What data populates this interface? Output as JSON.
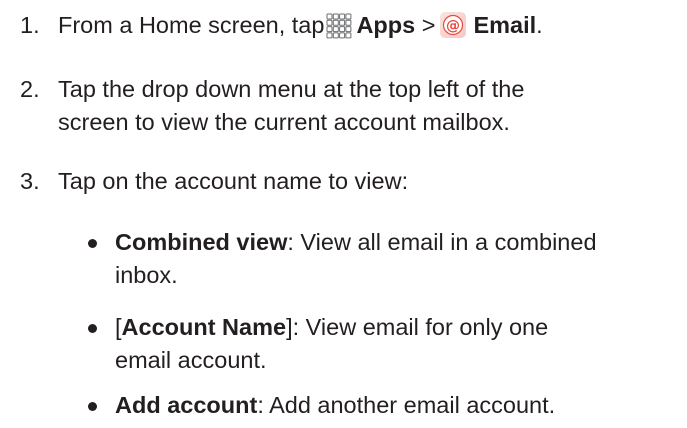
{
  "steps": [
    {
      "number": "1.",
      "text_before": "From a Home screen, tap",
      "apps_icon": "apps-grid-icon",
      "apps_label": "Apps",
      "separator": ">",
      "email_icon": "email-app-icon",
      "email_label": "Email",
      "end": "."
    },
    {
      "number": "2.",
      "line1": "Tap the drop down menu at the top left of the",
      "line2": "screen to view the current account mailbox."
    },
    {
      "number": "3.",
      "text": "Tap on the account name to view:"
    }
  ],
  "bullets": [
    {
      "term": "Combined view",
      "rest_line1": ": View all email in a combined",
      "rest_line2": "inbox."
    },
    {
      "open": "[",
      "term": "Account Name",
      "close": "]",
      "rest_line1": ": View email for only one",
      "rest_line2": "email account."
    },
    {
      "term": "Add account",
      "rest_line1": ": Add another email account."
    }
  ],
  "colors": {
    "text": "#231f20",
    "email_icon_red": "#e8493f",
    "apps_icon_gray": "#6d6e71"
  }
}
